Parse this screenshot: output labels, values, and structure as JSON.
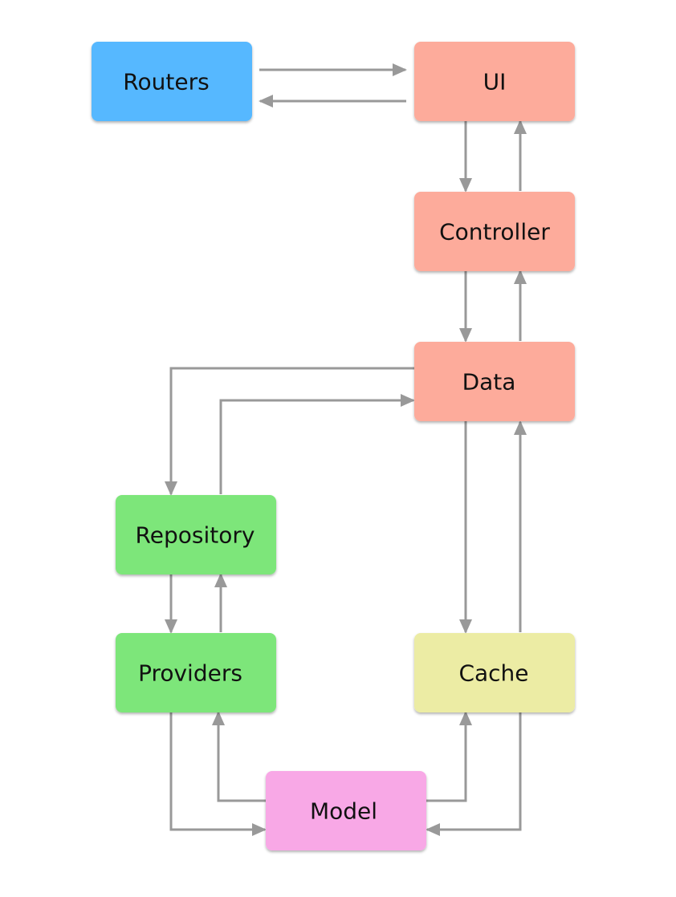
{
  "colors": {
    "routers": "#57b8ff",
    "presentation": "#fdab9b",
    "domain": "#7de67a",
    "cache": "#ececa4",
    "model": "#f8a8e6",
    "arrow": "#999999"
  },
  "nodes": {
    "routers": "Routers",
    "ui": "UI",
    "controller": "Controller",
    "data": "Data",
    "repository": "Repository",
    "providers": "Providers",
    "cache": "Cache",
    "model": "Model"
  },
  "edges": [
    {
      "from": "Routers",
      "to": "UI"
    },
    {
      "from": "UI",
      "to": "Routers"
    },
    {
      "from": "UI",
      "to": "Controller"
    },
    {
      "from": "Controller",
      "to": "UI"
    },
    {
      "from": "Controller",
      "to": "Data"
    },
    {
      "from": "Data",
      "to": "Controller"
    },
    {
      "from": "Data",
      "to": "Repository"
    },
    {
      "from": "Repository",
      "to": "Data"
    },
    {
      "from": "Data",
      "to": "Cache"
    },
    {
      "from": "Cache",
      "to": "Data"
    },
    {
      "from": "Repository",
      "to": "Providers"
    },
    {
      "from": "Providers",
      "to": "Repository"
    },
    {
      "from": "Providers",
      "to": "Model"
    },
    {
      "from": "Model",
      "to": "Providers"
    },
    {
      "from": "Model",
      "to": "Cache"
    },
    {
      "from": "Cache",
      "to": "Model"
    }
  ]
}
